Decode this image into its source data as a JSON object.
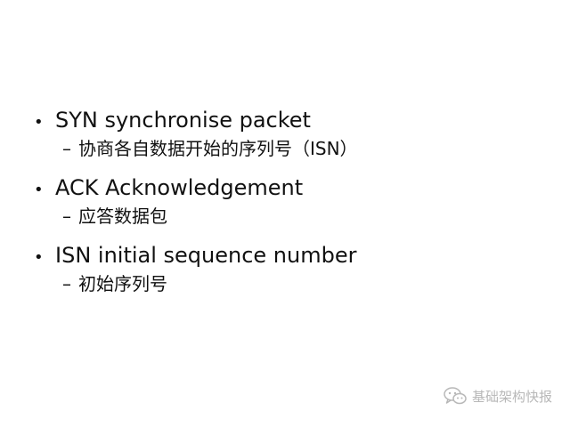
{
  "bullets": [
    {
      "text": "SYN synchronise packet",
      "sub": "协商各自数据开始的序列号（ISN）"
    },
    {
      "text": "ACK Acknowledgement",
      "sub": "应答数据包"
    },
    {
      "text": "ISN initial sequence number",
      "sub": "初始序列号"
    }
  ],
  "symbols": {
    "bullet": "•",
    "dash": "–"
  },
  "watermark": {
    "icon": "wechat-icon",
    "label": "基础架构快报",
    "color": "#b8b8b8"
  }
}
